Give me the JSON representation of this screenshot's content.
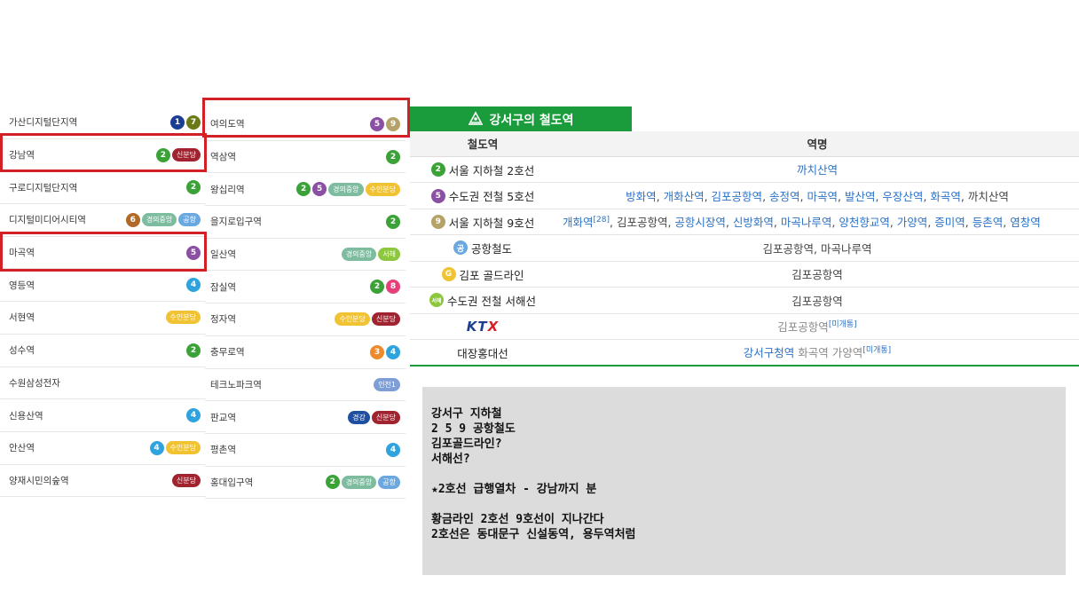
{
  "colors": {
    "line1": "#1b3e94",
    "line2": "#3ba238",
    "line4": "#2fa3dd",
    "line5": "#8b4fa3",
    "line6": "#b1692a",
    "line7": "#6b7a16",
    "line8": "#e6407a",
    "line9": "#b5a266",
    "line3": "#ef8a2b",
    "shinbundang": "#a0232f",
    "gyeongui": "#7ebca0",
    "airport": "#6aa8df",
    "suin": "#f1c232",
    "seohae": "#8dc63f",
    "gyeonggang": "#1f4fa0",
    "incheon1": "#7d9fd6",
    "highlight": "#d22027",
    "header_green": "#1a9b3c"
  },
  "left_list": [
    {
      "name": "가산디지털단지역",
      "badges": [
        {
          "t": "circ",
          "v": "1",
          "c": "line1"
        },
        {
          "t": "circ",
          "v": "7",
          "c": "line7"
        }
      ]
    },
    {
      "name": "강남역",
      "badges": [
        {
          "t": "circ",
          "v": "2",
          "c": "line2"
        },
        {
          "t": "pill",
          "v": "신분당",
          "c": "shinbundang"
        }
      ]
    },
    {
      "name": "구로디지털단지역",
      "badges": [
        {
          "t": "circ",
          "v": "2",
          "c": "line2"
        }
      ]
    },
    {
      "name": "디지털미디어시티역",
      "badges": [
        {
          "t": "circ",
          "v": "6",
          "c": "line6"
        },
        {
          "t": "pill",
          "v": "경의중앙",
          "c": "gyeongui"
        },
        {
          "t": "pill",
          "v": "공항",
          "c": "airport"
        }
      ]
    },
    {
      "name": "마곡역",
      "badges": [
        {
          "t": "circ",
          "v": "5",
          "c": "line5"
        }
      ]
    },
    {
      "name": "영등역",
      "badges": [
        {
          "t": "circ",
          "v": "4",
          "c": "line4"
        }
      ]
    },
    {
      "name": "서현역",
      "badges": [
        {
          "t": "pill",
          "v": "수인분당",
          "c": "suin"
        }
      ]
    },
    {
      "name": "성수역",
      "badges": [
        {
          "t": "circ",
          "v": "2",
          "c": "line2"
        }
      ]
    },
    {
      "name": "수원삼성전자",
      "badges": []
    },
    {
      "name": "신용산역",
      "badges": [
        {
          "t": "circ",
          "v": "4",
          "c": "line4"
        }
      ]
    },
    {
      "name": "안산역",
      "badges": [
        {
          "t": "circ",
          "v": "4",
          "c": "line4"
        },
        {
          "t": "pill",
          "v": "수인분당",
          "c": "suin"
        }
      ]
    },
    {
      "name": "양재시민의숲역",
      "badges": [
        {
          "t": "pill",
          "v": "신분당",
          "c": "shinbundang"
        }
      ]
    }
  ],
  "right_list": [
    {
      "name": "여의도역",
      "badges": [
        {
          "t": "circ",
          "v": "5",
          "c": "line5"
        },
        {
          "t": "circ",
          "v": "9",
          "c": "line9"
        }
      ]
    },
    {
      "name": "역삼역",
      "badges": [
        {
          "t": "circ",
          "v": "2",
          "c": "line2"
        }
      ]
    },
    {
      "name": "왕십리역",
      "badges": [
        {
          "t": "circ",
          "v": "2",
          "c": "line2"
        },
        {
          "t": "circ",
          "v": "5",
          "c": "line5"
        },
        {
          "t": "pill",
          "v": "경의중앙",
          "c": "gyeongui"
        },
        {
          "t": "pill",
          "v": "수인분당",
          "c": "suin"
        }
      ]
    },
    {
      "name": "을지로입구역",
      "badges": [
        {
          "t": "circ",
          "v": "2",
          "c": "line2"
        }
      ]
    },
    {
      "name": "일산역",
      "badges": [
        {
          "t": "pill",
          "v": "경의중앙",
          "c": "gyeongui"
        },
        {
          "t": "pill",
          "v": "서해",
          "c": "seohae"
        }
      ]
    },
    {
      "name": "잠실역",
      "badges": [
        {
          "t": "circ",
          "v": "2",
          "c": "line2"
        },
        {
          "t": "circ",
          "v": "8",
          "c": "line8"
        }
      ]
    },
    {
      "name": "정자역",
      "badges": [
        {
          "t": "pill",
          "v": "수인분당",
          "c": "suin"
        },
        {
          "t": "pill",
          "v": "신분당",
          "c": "shinbundang"
        }
      ]
    },
    {
      "name": "충무로역",
      "badges": [
        {
          "t": "circ",
          "v": "3",
          "c": "line3"
        },
        {
          "t": "circ",
          "v": "4",
          "c": "line4"
        }
      ]
    },
    {
      "name": "테크노파크역",
      "badges": [
        {
          "t": "pill",
          "v": "인천1",
          "c": "incheon1"
        }
      ]
    },
    {
      "name": "판교역",
      "badges": [
        {
          "t": "pill",
          "v": "경강",
          "c": "gyeonggang"
        },
        {
          "t": "pill",
          "v": "신분당",
          "c": "shinbundang"
        }
      ]
    },
    {
      "name": "평촌역",
      "badges": [
        {
          "t": "circ",
          "v": "4",
          "c": "line4"
        }
      ]
    },
    {
      "name": "홍대입구역",
      "badges": [
        {
          "t": "circ",
          "v": "2",
          "c": "line2"
        },
        {
          "t": "pill",
          "v": "경의중앙",
          "c": "gyeongui"
        },
        {
          "t": "pill",
          "v": "공항",
          "c": "airport"
        }
      ]
    }
  ],
  "rail": {
    "title": "강서구의 철도역",
    "col_line": "철도역",
    "col_station": "역명",
    "rows": [
      {
        "icon": "2",
        "icon_color": "line2",
        "line": "서울 지하철 2호선",
        "align": "center",
        "stations": [
          {
            "n": "까치산역",
            "link": true
          }
        ]
      },
      {
        "icon": "5",
        "icon_color": "line5",
        "line": "수도권 전철 5호선",
        "align": "center",
        "stations": [
          {
            "n": "방화역",
            "link": true
          },
          {
            "n": "개화산역",
            "link": true
          },
          {
            "n": "김포공항역",
            "link": true
          },
          {
            "n": "송정역",
            "link": true
          },
          {
            "n": "마곡역",
            "link": true
          },
          {
            "n": "발산역",
            "link": true
          },
          {
            "n": "우장산역",
            "link": true
          },
          {
            "n": "화곡역",
            "link": true
          },
          {
            "n": "까치산역",
            "link": false
          }
        ]
      },
      {
        "icon": "9",
        "icon_color": "line9",
        "line": "서울 지하철 9호선",
        "align": "left",
        "stations": [
          {
            "n": "개화역",
            "link": true,
            "sup": "[28]"
          },
          {
            "n": "김포공항역",
            "link": false
          },
          {
            "n": "공항시장역",
            "link": true
          },
          {
            "n": "신방화역",
            "link": true
          },
          {
            "n": "마곡나루역",
            "link": true
          },
          {
            "n": "양천향교역",
            "link": true
          },
          {
            "n": "가양역",
            "link": true
          },
          {
            "n": "증미역",
            "link": true
          },
          {
            "n": "등촌역",
            "link": true
          },
          {
            "n": "염창역",
            "link": true
          }
        ]
      },
      {
        "icon": "공",
        "icon_color": "airport",
        "line": "공항철도",
        "align": "center",
        "stations": [
          {
            "n": "김포공항역",
            "link": false
          },
          {
            "n": "마곡나루역",
            "link": false
          }
        ]
      },
      {
        "icon": "G",
        "icon_color": "suin",
        "line": "김포 골드라인",
        "align": "center",
        "stations": [
          {
            "n": "김포공항역",
            "link": false
          }
        ]
      },
      {
        "icon": "서해",
        "icon_color": "seohae",
        "line": "수도권 전철 서해선",
        "align": "center",
        "stations": [
          {
            "n": "김포공항역",
            "link": false
          }
        ]
      }
    ],
    "ktx": {
      "logo": "KTX",
      "station": "김포공항역",
      "sup": "[미개통]"
    },
    "daejang": {
      "line": "대장홍대선",
      "stations": [
        {
          "n": "강서구청역",
          "link": true
        },
        {
          "n": "화곡역",
          "link": false
        },
        {
          "n": "가양역",
          "link": false
        }
      ],
      "sup": "[미개통]"
    }
  },
  "note": {
    "lines": [
      "강서구 지하철",
      "2 5 9 공항철도",
      "김포골드라인?",
      "서해선?",
      "",
      "★2호선 급행열차 - 강남까지 분",
      "",
      "황금라인 2호선 9호선이 지나간다",
      "2호선은 동대문구 신설동역, 용두역처럼"
    ]
  }
}
